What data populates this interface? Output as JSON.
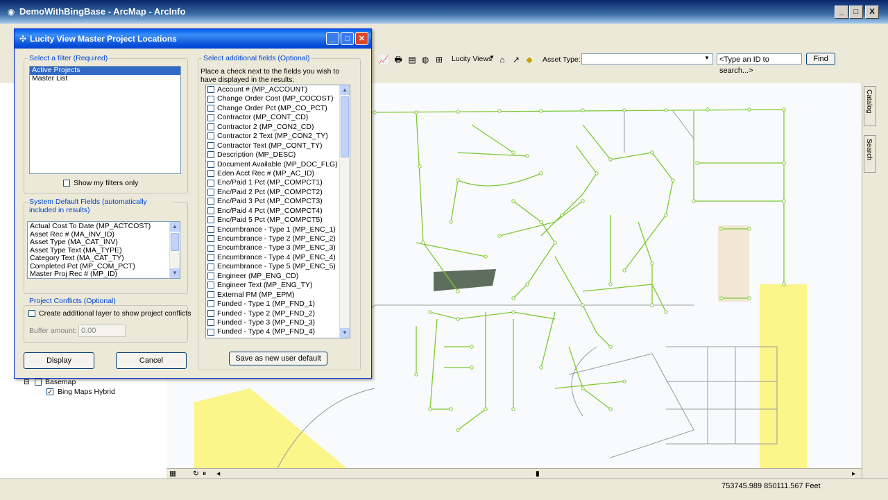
{
  "main_window": {
    "title": "DemoWithBingBase - ArcMap - ArcInfo",
    "minimize": "_",
    "maximize": "□",
    "close": "X"
  },
  "toolbar": {
    "lucity_views": "Lucity Views",
    "asset_type_label": "Asset Type:",
    "asset_type_value": "",
    "search_placeholder": "<Type an ID to search...>",
    "find_button": "Find"
  },
  "side_tabs": {
    "catalog": "Catalog",
    "search": "Search"
  },
  "toc": {
    "basemap_label": "Basemap",
    "bing_label": "Bing Maps Hybrid"
  },
  "status": {
    "coordinates": "753745.989  850111.567 Feet"
  },
  "dialog": {
    "title": "Lucity View Master Project Locations",
    "filter_group": "Select a filter (Required)",
    "filters": [
      "Active Projects",
      "Master List"
    ],
    "selected_filter": "Active Projects",
    "show_my_filters": "Show my filters only",
    "system_group": "System Default Fields (automatically included in results)",
    "system_fields": [
      "Actual Cost To Date (MP_ACTCOST)",
      "Asset Rec # (MA_INV_ID)",
      "Asset Type (MA_CAT_INV)",
      "Asset Type Text (MA_TYPE)",
      "Category Text (MA_CAT_TY)",
      "Completed Pct (MP_COM_PCT)",
      "Master Proj Rec # (MP_ID)"
    ],
    "conflicts_group": "Project Conflicts (Optional)",
    "create_layer": "Create additional layer to show project conflicts",
    "buffer_label": "Buffer amount:",
    "buffer_value": "0.00",
    "display_button": "Display",
    "cancel_button": "Cancel",
    "additional_group": "Select additional fields (Optional)",
    "additional_hint": "Place a check next to the fields you wish to have displayed in the results:",
    "additional_fields": [
      "Account # (MP_ACCOUNT)",
      "Change Order Cost (MP_COCOST)",
      "Change Order Pct (MP_CO_PCT)",
      "Contractor (MP_CONT_CD)",
      "Contractor 2 (MP_CON2_CD)",
      "Contractor 2 Text (MP_CON2_TY)",
      "Contractor Text (MP_CONT_TY)",
      "Description (MP_DESC)",
      "Document Available (MP_DOC_FLG)",
      "Eden Acct Rec # (MP_AC_ID)",
      "Enc/Paid 1 Pct (MP_COMPCT1)",
      "Enc/Paid 2 Pct (MP_COMPCT2)",
      "Enc/Paid 3 Pct (MP_COMPCT3)",
      "Enc/Paid 4 Pct (MP_COMPCT4)",
      "Enc/Paid 5 Pct (MP_COMPCT5)",
      "Encumbrance - Type 1 (MP_ENC_1)",
      "Encumbrance - Type 2 (MP_ENC_2)",
      "Encumbrance - Type 3 (MP_ENC_3)",
      "Encumbrance - Type 4 (MP_ENC_4)",
      "Encumbrance - Type 5 (MP_ENC_5)",
      "Engineer (MP_ENG_CD)",
      "Engineer Text (MP_ENG_TY)",
      "External PM (MP_EPM)",
      "Funded - Type 1 (MP_FND_1)",
      "Funded - Type 2 (MP_FND_2)",
      "Funded - Type 3 (MP_FND_3)",
      "Funded - Type 4 (MP_FND_4)"
    ],
    "save_default_button": "Save as new user default"
  },
  "colors": {
    "pipe": "#7cc832",
    "parcel": "#9a9a9a",
    "yellow_area": "#fbf58a",
    "dialog_bg": "#ece9d8",
    "selection": "#316ac5"
  }
}
